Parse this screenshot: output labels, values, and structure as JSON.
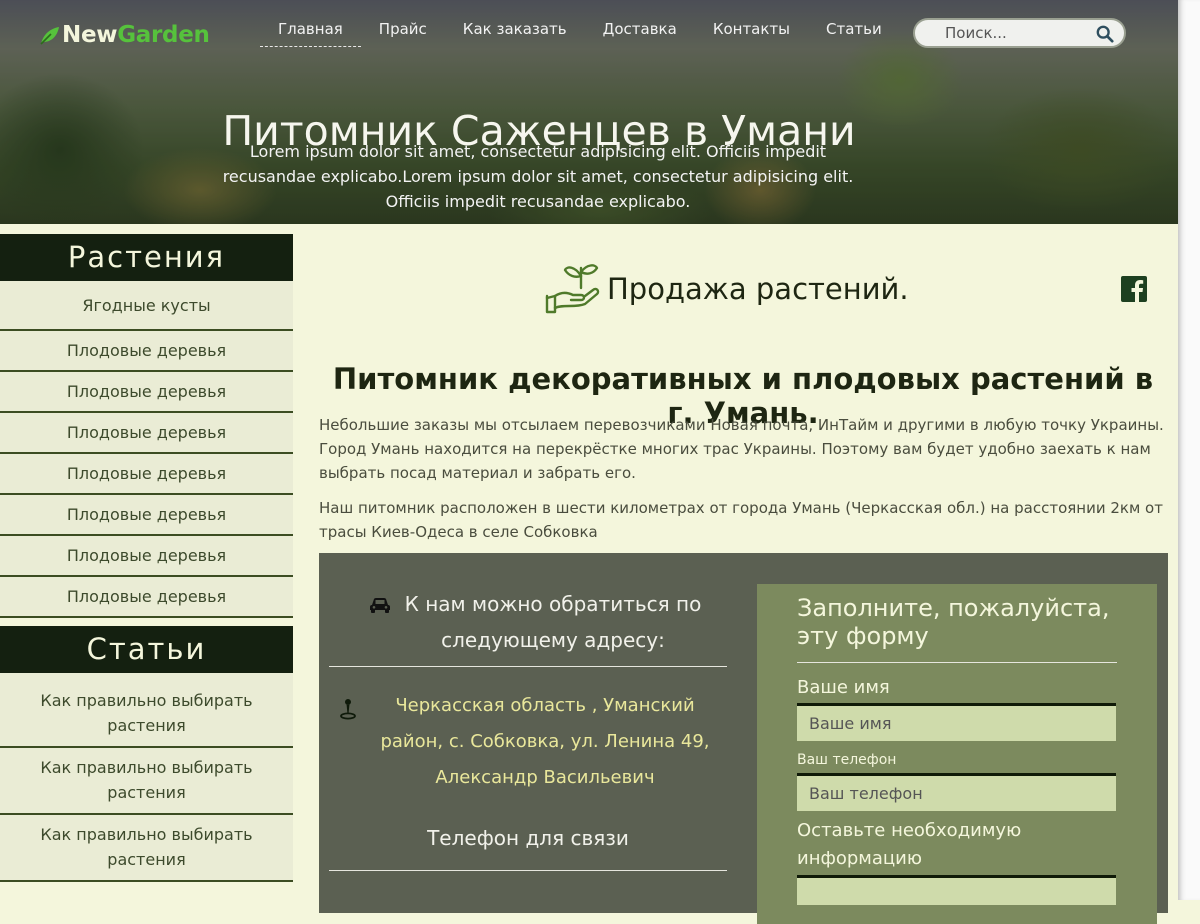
{
  "logo": {
    "part1": "New",
    "part2": "Garden"
  },
  "nav": {
    "items": [
      {
        "label": "Главная"
      },
      {
        "label": "Прайс"
      },
      {
        "label": "Как заказать"
      },
      {
        "label": "Доставка"
      },
      {
        "label": "Контакты"
      },
      {
        "label": "Статьи"
      }
    ]
  },
  "search": {
    "placeholder": "Поиск..."
  },
  "hero": {
    "title": "Питомник Саженцев в Умани",
    "text": "Lorem ipsum dolor sit amet, consectetur adipisicing elit. Officiis impedit recusandae explicabo.Lorem ipsum dolor sit amet, consectetur adipisicing elit. Officiis impedit recusandae explicabo."
  },
  "sidebar": {
    "plants": {
      "title": "Растения",
      "items": [
        "Ягодные кусты",
        "Плодовые деревья",
        "Плодовые деревья",
        "Плодовые деревья",
        "Плодовые деревья",
        "Плодовые деревья",
        "Плодовые деревья",
        "Плодовые деревья"
      ]
    },
    "articles": {
      "title": "Статьи",
      "items": [
        "Как правильно выбирать растения",
        "Как правильно выбирать растения",
        "Как правильно выбирать растения"
      ]
    }
  },
  "main": {
    "title": "Продажа растений.",
    "subtitle": "Питомник декоративных и плодовых растений в г. Умань.",
    "para1": "Небольшие заказы мы отсылаем перевозчиками Новая почта, ИнТайм и другими в любую точку Украины. Город Умань находится на перекрёстке многих трас Украины. Поэтому вам будет удобно заехать к нам выбрать посад материал и забрать его.",
    "para2": "Наш питомник расположен в шести километрах от города Умань (Черкасская обл.) на расстоянии 2км от трасы Киев-Одеса в селе Собковка"
  },
  "contact": {
    "heading": "К нам можно обратиться по следующему адресу:",
    "address": "Черкасская область , Уманский район, с. Собковка, ул. Ленина 49, Александр Васильевич",
    "phone_title": "Телефон для связи"
  },
  "form": {
    "title": "Заполните, пожалуйста, эту форму",
    "name_label": "Ваше имя",
    "name_placeholder": "Ваше имя",
    "phone_label": "Ваш телефон",
    "phone_placeholder": "Ваш телефон",
    "info_label": "Оставьте необходимую информацию"
  },
  "colors": {
    "accent": "#56c23c",
    "dark": "#142010",
    "panel": "#5b6052",
    "form": "#7c8a5e",
    "address": "#e9e79b"
  }
}
